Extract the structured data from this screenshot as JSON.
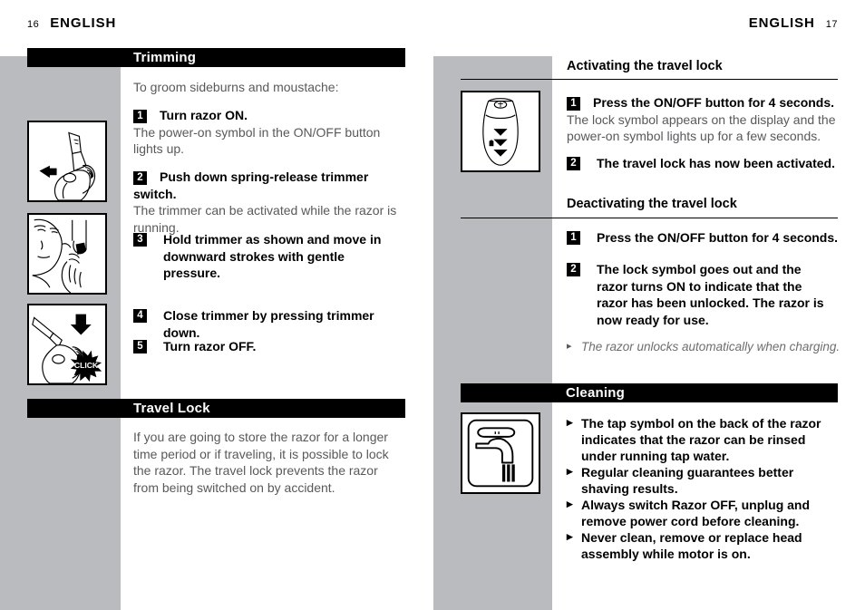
{
  "page": {
    "left_folio": "16",
    "right_folio": "17",
    "left_runhead": "ENGLISH",
    "right_runhead": "ENGLISH",
    "grey": "#babbbe",
    "black": "#000000"
  },
  "left_column": {
    "section_bar": "Trimming",
    "intro": "To groom sideburns and moustache:",
    "steps": [
      {
        "num": "1",
        "lead": "Turn razor ON.",
        "follow": "The power-on symbol in the ON/OFF button lights up."
      },
      {
        "num": "2",
        "lead": "Push down spring-release trimmer switch.",
        "follow": "The trimmer can be activated while the razor is running."
      },
      {
        "num": "3",
        "lead": "Hold trimmer as shown and move in downward strokes with gentle pressure.",
        "follow": ""
      },
      {
        "num": "4",
        "lead": "Close trimmer by pressing trimmer down.",
        "follow": ""
      },
      {
        "num": "5",
        "lead": "Turn razor OFF.",
        "follow": ""
      }
    ],
    "travel_lock_bar": "Travel Lock",
    "travel_lock_body": "If you are going to store the razor for a longer time period or if traveling, it is possible to lock the razor. The travel lock prevents the razor from being switched on by accident.",
    "illustrations": [
      {
        "name": "razor-trimmer-open",
        "caption_text": ""
      },
      {
        "name": "man-trimming-sideburn",
        "caption_text": ""
      },
      {
        "name": "razor-trimmer-close-click",
        "caption_text": "CLICK"
      }
    ]
  },
  "right_column": {
    "activating_heading": "Activating the travel lock",
    "activating_steps": [
      {
        "num": "1",
        "lead": "Press the ON/OFF button for 4 seconds.",
        "follow": "The lock symbol appears on the display and the power-on symbol lights up for a few seconds."
      },
      {
        "num": "2",
        "lead": "The travel lock has now been activated.",
        "follow": ""
      }
    ],
    "deactivating_heading": "Deactivating the travel lock",
    "deactivating_steps": [
      {
        "num": "1",
        "lead": "Press the ON/OFF button for 4 seconds.",
        "follow": ""
      },
      {
        "num": "2",
        "lead": "The lock symbol goes out and the razor turns ON to indicate that the razor has been unlocked. The razor is now ready for use.",
        "follow": ""
      }
    ],
    "deactivating_note": "The razor unlocks automatically when charging.",
    "cleaning_bar": "Cleaning",
    "cleaning_bullets": [
      "The tap symbol on the back of the razor indicates that the razor can be rinsed under running tap water.",
      "Regular cleaning guarantees better shaving results.",
      "Always switch Razor OFF, unplug and remove power cord before cleaning.",
      "Never clean, remove or replace head assembly while motor is on."
    ],
    "illustrations": [
      {
        "name": "razor-display-lock-symbol",
        "caption_text": ""
      },
      {
        "name": "tap-water-symbol",
        "caption_text": ""
      }
    ]
  }
}
